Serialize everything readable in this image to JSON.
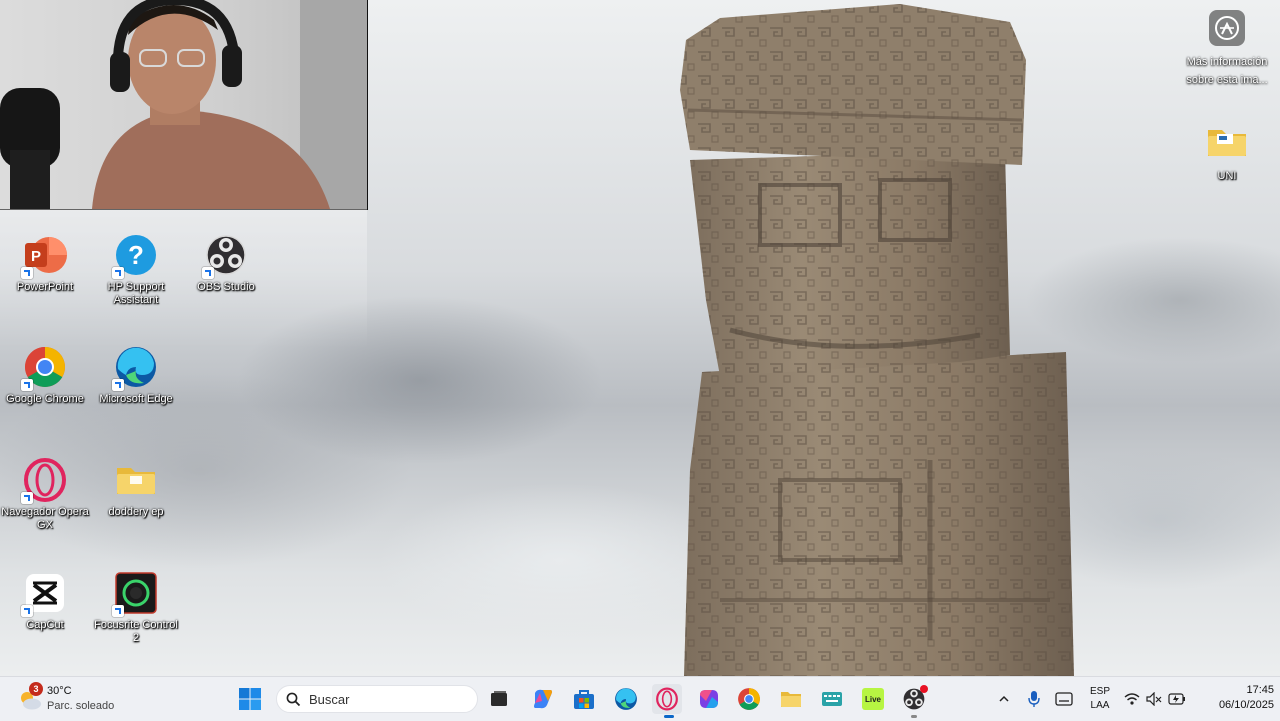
{
  "desktop": {
    "icons": [
      {
        "label": "PowerPoint",
        "icon": "powerpoint-icon"
      },
      {
        "label": "HP Support Assistant",
        "icon": "hp-support-icon"
      },
      {
        "label": "OBS Studio",
        "icon": "obs-icon"
      },
      {
        "label": "Google Chrome",
        "icon": "chrome-icon"
      },
      {
        "label": "Microsoft Edge",
        "icon": "edge-icon"
      },
      {
        "label": "Navegador Opera GX",
        "icon": "opera-gx-icon"
      },
      {
        "label": "doddery ep",
        "icon": "folder-icon"
      },
      {
        "label": "CapCut",
        "icon": "capcut-icon"
      },
      {
        "label": "Focusrite Control 2",
        "icon": "focusrite-icon"
      }
    ],
    "right_icons": [
      {
        "label": "Más información sobre esta ima...",
        "icon": "camera-info-icon"
      },
      {
        "label": "UNI",
        "icon": "folder-icon"
      }
    ]
  },
  "taskbar": {
    "weather": {
      "temperature": "30°C",
      "condition": "Parc. soleado",
      "badge": "3"
    },
    "search": {
      "placeholder": "Buscar"
    },
    "apps": [
      "start-icon",
      "task-view-icon",
      "copilot-icon",
      "store-icon",
      "edge-icon",
      "opera-gx-icon",
      "office-icon",
      "chrome-icon",
      "file-explorer-icon",
      "keyboard-icon",
      "live-icon",
      "obs-icon"
    ],
    "apps_label_live": "Live",
    "tray": {
      "language": "ESP",
      "layout": "LAA",
      "time": "17:45",
      "date": "06/10/2025"
    }
  }
}
